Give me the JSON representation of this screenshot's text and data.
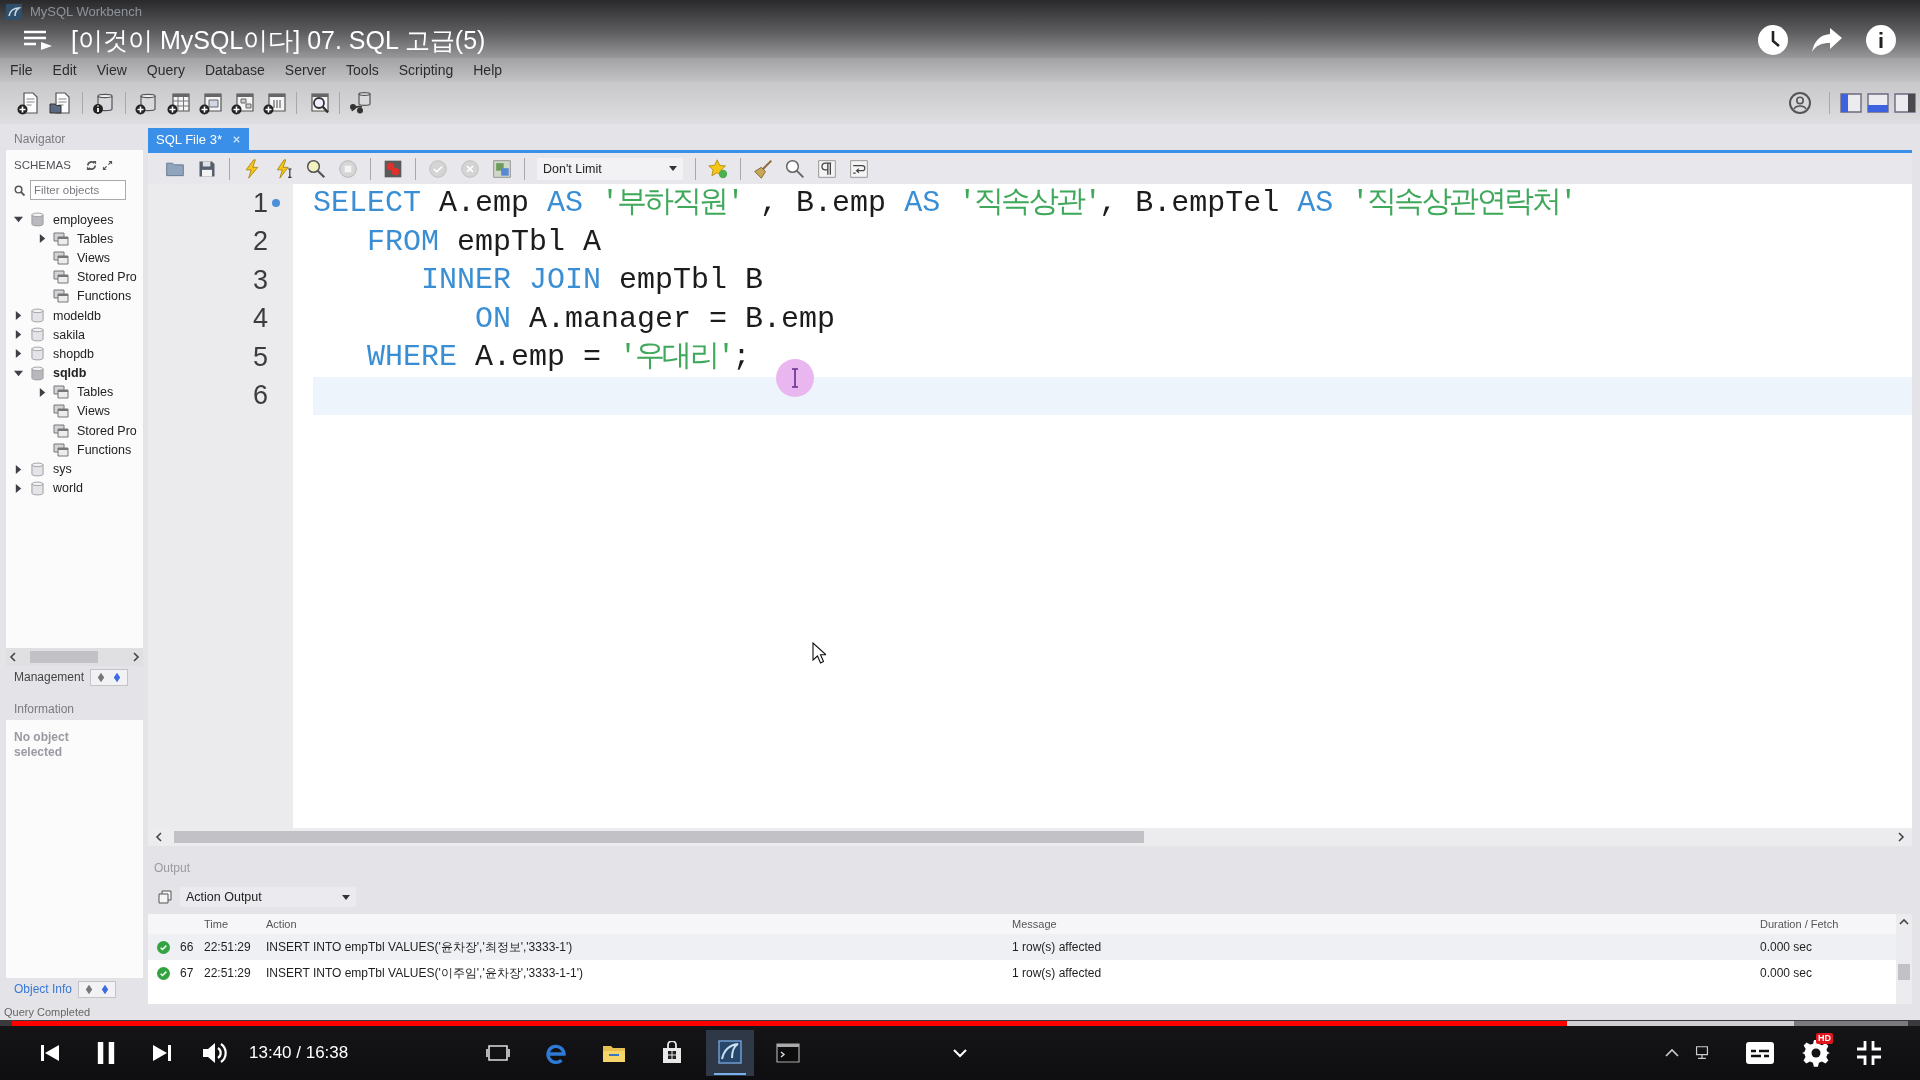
{
  "video": {
    "title": "[이것이 MySQL이다] 07. SQL 고급(5)",
    "playing": true,
    "time": "13:40 / 16:38",
    "progress": {
      "level": 0.82
    },
    "buffer": {
      "level": 0.94
    },
    "quality_badge": "HD"
  },
  "window": {
    "title": "MySQL Workbench"
  },
  "menu": [
    "File",
    "Edit",
    "View",
    "Query",
    "Database",
    "Server",
    "Tools",
    "Scripting",
    "Help"
  ],
  "panel_toggles": [
    {
      "on": true
    },
    {
      "on": true
    },
    {
      "on": false
    }
  ],
  "navigator": {
    "title": "Navigator",
    "schemas_label": "SCHEMAS",
    "filter": {
      "placeholder": "Filter objects"
    },
    "schemas": [
      {
        "label": "employees",
        "expanded": true,
        "default": false,
        "children": [
          {
            "label": "Tables",
            "empty": false,
            "expanded": false
          },
          {
            "label": "Views",
            "empty": true
          },
          {
            "label": "Stored Pro",
            "empty": true
          },
          {
            "label": "Functions",
            "empty": true
          }
        ]
      },
      {
        "label": "modeldb",
        "expanded": false,
        "default": false
      },
      {
        "label": "sakila",
        "expanded": false,
        "default": false
      },
      {
        "label": "shopdb",
        "expanded": false,
        "default": false
      },
      {
        "label": "sqldb",
        "expanded": true,
        "default": true,
        "children": [
          {
            "label": "Tables",
            "empty": false,
            "expanded": false
          },
          {
            "label": "Views",
            "empty": true
          },
          {
            "label": "Stored Pro",
            "empty": true
          },
          {
            "label": "Functions",
            "empty": true
          }
        ]
      },
      {
        "label": "sys",
        "expanded": false,
        "default": false
      },
      {
        "label": "world",
        "expanded": false,
        "default": false
      }
    ],
    "management_tab": "Management",
    "management_switch": [
      {
        "selected": false
      },
      {
        "selected": true
      }
    ],
    "information_title": "Information",
    "information_text": "No object selected",
    "object_info_tab": "Object Info",
    "object_info_switch": [
      {
        "selected": false
      },
      {
        "selected": true
      }
    ]
  },
  "editor": {
    "tabs": [
      {
        "label": "SQL File 3*",
        "selected": true
      }
    ],
    "limit": "Don't Limit",
    "lines": [
      {
        "number": "1",
        "marker": true,
        "current": false,
        "tokens": [
          {
            "text": "SELECT",
            "kind": "keyword"
          },
          {
            "text": " A.emp ",
            "kind": "plain"
          },
          {
            "text": "AS ",
            "kind": "keyword"
          },
          {
            "text": "'부하직원'",
            "kind": "string"
          },
          {
            "text": " , B.emp ",
            "kind": "plain"
          },
          {
            "text": "AS ",
            "kind": "keyword"
          },
          {
            "text": "'직속상관'",
            "kind": "string"
          },
          {
            "text": ", B.empTel ",
            "kind": "plain"
          },
          {
            "text": "AS ",
            "kind": "keyword"
          },
          {
            "text": "'직속상관연락처'",
            "kind": "string"
          }
        ]
      },
      {
        "number": "2",
        "marker": false,
        "current": false,
        "tokens": [
          {
            "text": "   FROM",
            "kind": "keyword"
          },
          {
            "text": " empTbl A",
            "kind": "plain"
          }
        ]
      },
      {
        "number": "3",
        "marker": false,
        "current": false,
        "tokens": [
          {
            "text": "      INNER JOIN",
            "kind": "keyword"
          },
          {
            "text": " empTbl B",
            "kind": "plain"
          }
        ]
      },
      {
        "number": "4",
        "marker": false,
        "current": false,
        "tokens": [
          {
            "text": "         ON",
            "kind": "keyword"
          },
          {
            "text": " A.manager = B.emp",
            "kind": "plain"
          }
        ]
      },
      {
        "number": "5",
        "marker": false,
        "current": false,
        "tokens": [
          {
            "text": "   WHERE",
            "kind": "keyword"
          },
          {
            "text": " A.emp = ",
            "kind": "plain"
          },
          {
            "text": "'우대리'",
            "kind": "string"
          },
          {
            "text": ";",
            "kind": "plain"
          }
        ]
      },
      {
        "number": "6",
        "marker": false,
        "current": true
      }
    ]
  },
  "output": {
    "title": "Output",
    "mode": "Action Output",
    "columns": [
      "Time",
      "Action",
      "Message",
      "Duration / Fetch"
    ],
    "rows": [
      {
        "ok": true,
        "number": "66",
        "time": "22:51:29",
        "action": "INSERT INTO empTbl VALUES('윤차장','최정보','3333-1')",
        "message": "1 row(s) affected",
        "duration": "0.000 sec"
      },
      {
        "ok": true,
        "number": "67",
        "time": "22:51:29",
        "action": "INSERT INTO empTbl VALUES('이주임','윤차장','3333-1-1')",
        "message": "1 row(s) affected",
        "duration": "0.000 sec"
      }
    ]
  },
  "status_bar": "Query Completed"
}
